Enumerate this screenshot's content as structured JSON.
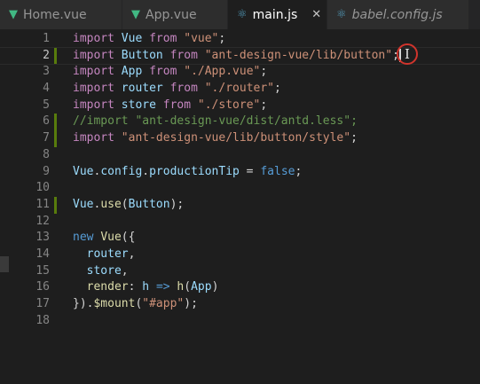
{
  "tabs": [
    {
      "label": "Home.vue",
      "icon": "vue-icon",
      "active": false
    },
    {
      "label": "App.vue",
      "icon": "vue-icon",
      "active": false
    },
    {
      "label": "main.js",
      "icon": "react-icon",
      "active": true,
      "close": "✕"
    },
    {
      "label": "babel.config.js",
      "icon": "react-icon",
      "active": false
    }
  ],
  "editor": {
    "current_line": 2,
    "lines": [
      {
        "n": "1",
        "t": [
          {
            "k": "kw2",
            "s": "import"
          },
          {
            "k": "plain",
            "s": " "
          },
          {
            "k": "id",
            "s": "Vue"
          },
          {
            "k": "plain",
            "s": " "
          },
          {
            "k": "kw2",
            "s": "from"
          },
          {
            "k": "plain",
            "s": " "
          },
          {
            "k": "str",
            "s": "\"vue\""
          },
          {
            "k": "plain",
            "s": ";"
          }
        ]
      },
      {
        "n": "2",
        "t": [
          {
            "k": "kw2",
            "s": "import"
          },
          {
            "k": "plain",
            "s": " "
          },
          {
            "k": "id",
            "s": "Button"
          },
          {
            "k": "plain",
            "s": " "
          },
          {
            "k": "kw2",
            "s": "from"
          },
          {
            "k": "plain",
            "s": " "
          },
          {
            "k": "str",
            "s": "\"ant-design-vue/lib/button\""
          },
          {
            "k": "plain",
            "s": ";"
          }
        ]
      },
      {
        "n": "3",
        "t": [
          {
            "k": "kw2",
            "s": "import"
          },
          {
            "k": "plain",
            "s": " "
          },
          {
            "k": "id",
            "s": "App"
          },
          {
            "k": "plain",
            "s": " "
          },
          {
            "k": "kw2",
            "s": "from"
          },
          {
            "k": "plain",
            "s": " "
          },
          {
            "k": "str",
            "s": "\"./App.vue\""
          },
          {
            "k": "plain",
            "s": ";"
          }
        ]
      },
      {
        "n": "4",
        "t": [
          {
            "k": "kw2",
            "s": "import"
          },
          {
            "k": "plain",
            "s": " "
          },
          {
            "k": "id",
            "s": "router"
          },
          {
            "k": "plain",
            "s": " "
          },
          {
            "k": "kw2",
            "s": "from"
          },
          {
            "k": "plain",
            "s": " "
          },
          {
            "k": "str",
            "s": "\"./router\""
          },
          {
            "k": "plain",
            "s": ";"
          }
        ]
      },
      {
        "n": "5",
        "t": [
          {
            "k": "kw2",
            "s": "import"
          },
          {
            "k": "plain",
            "s": " "
          },
          {
            "k": "id",
            "s": "store"
          },
          {
            "k": "plain",
            "s": " "
          },
          {
            "k": "kw2",
            "s": "from"
          },
          {
            "k": "plain",
            "s": " "
          },
          {
            "k": "str",
            "s": "\"./store\""
          },
          {
            "k": "plain",
            "s": ";"
          }
        ]
      },
      {
        "n": "6",
        "t": [
          {
            "k": "cmt",
            "s": "//import \"ant-design-vue/dist/antd.less\";"
          }
        ]
      },
      {
        "n": "7",
        "t": [
          {
            "k": "kw2",
            "s": "import"
          },
          {
            "k": "plain",
            "s": " "
          },
          {
            "k": "str",
            "s": "\"ant-design-vue/lib/button/style\""
          },
          {
            "k": "plain",
            "s": ";"
          }
        ]
      },
      {
        "n": "8",
        "t": []
      },
      {
        "n": "9",
        "t": [
          {
            "k": "id",
            "s": "Vue"
          },
          {
            "k": "plain",
            "s": "."
          },
          {
            "k": "id",
            "s": "config"
          },
          {
            "k": "plain",
            "s": "."
          },
          {
            "k": "id",
            "s": "productionTip"
          },
          {
            "k": "plain",
            "s": " = "
          },
          {
            "k": "kw",
            "s": "false"
          },
          {
            "k": "plain",
            "s": ";"
          }
        ]
      },
      {
        "n": "10",
        "t": []
      },
      {
        "n": "11",
        "t": [
          {
            "k": "id",
            "s": "Vue"
          },
          {
            "k": "plain",
            "s": "."
          },
          {
            "k": "fn",
            "s": "use"
          },
          {
            "k": "plain",
            "s": "("
          },
          {
            "k": "id",
            "s": "Button"
          },
          {
            "k": "plain",
            "s": ");"
          }
        ]
      },
      {
        "n": "12",
        "t": []
      },
      {
        "n": "13",
        "t": [
          {
            "k": "kw",
            "s": "new"
          },
          {
            "k": "plain",
            "s": " "
          },
          {
            "k": "fn",
            "s": "Vue"
          },
          {
            "k": "plain",
            "s": "({"
          }
        ]
      },
      {
        "n": "14",
        "t": [
          {
            "k": "plain",
            "s": "  "
          },
          {
            "k": "id",
            "s": "router"
          },
          {
            "k": "plain",
            "s": ","
          }
        ]
      },
      {
        "n": "15",
        "t": [
          {
            "k": "plain",
            "s": "  "
          },
          {
            "k": "id",
            "s": "store"
          },
          {
            "k": "plain",
            "s": ","
          }
        ]
      },
      {
        "n": "16",
        "t": [
          {
            "k": "plain",
            "s": "  "
          },
          {
            "k": "fn",
            "s": "render"
          },
          {
            "k": "plain",
            "s": ": "
          },
          {
            "k": "id",
            "s": "h"
          },
          {
            "k": "plain",
            "s": " "
          },
          {
            "k": "kw",
            "s": "=>"
          },
          {
            "k": "plain",
            "s": " "
          },
          {
            "k": "fn",
            "s": "h"
          },
          {
            "k": "plain",
            "s": "("
          },
          {
            "k": "id",
            "s": "App"
          },
          {
            "k": "plain",
            "s": ")"
          }
        ]
      },
      {
        "n": "17",
        "t": [
          {
            "k": "plain",
            "s": "})."
          },
          {
            "k": "fn",
            "s": "$mount"
          },
          {
            "k": "plain",
            "s": "("
          },
          {
            "k": "str",
            "s": "\"#app\""
          },
          {
            "k": "plain",
            "s": ");"
          }
        ]
      },
      {
        "n": "18",
        "t": []
      }
    ],
    "modified_lines": [
      "2",
      "6",
      "7",
      "11"
    ]
  },
  "pointer": {
    "glyph": "I",
    "icon": "text-cursor-icon"
  },
  "colors": {
    "background": "#1e1e1e",
    "tab_inactive": "#2d2d2d",
    "vue_green": "#41b883",
    "keyword_purple": "#c586c0",
    "string_orange": "#ce9178",
    "comment_green": "#6a9955",
    "modified_bar": "#587c0c",
    "cursor_ring": "#d0342c"
  }
}
